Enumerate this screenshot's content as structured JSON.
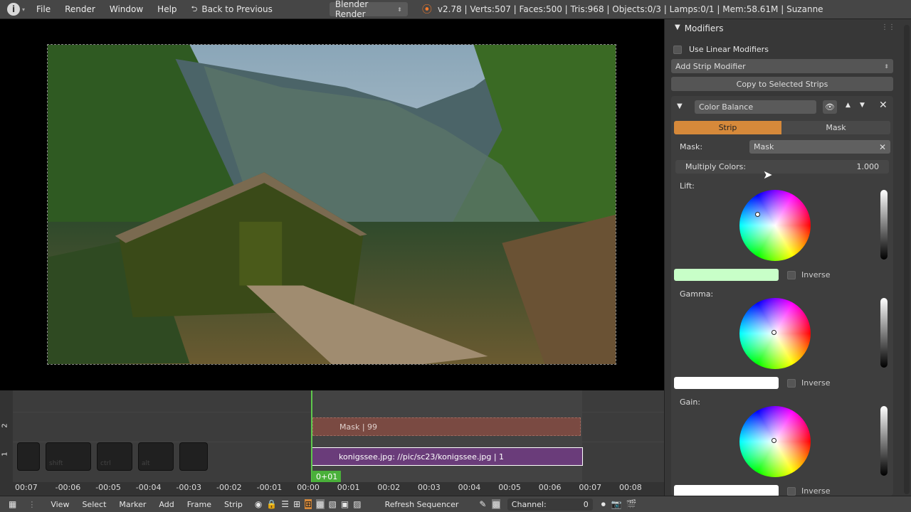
{
  "topbar": {
    "menus": [
      "File",
      "Render",
      "Window",
      "Help"
    ],
    "back": "Back to Previous",
    "engine": "Blender Render",
    "stats": "v2.78 | Verts:507 | Faces:500 | Tris:968 | Objects:0/3 | Lamps:0/1 | Mem:58.61M | Suzanne"
  },
  "panel": {
    "header": "Modifiers",
    "use_linear": "Use Linear Modifiers",
    "add_strip": "Add Strip Modifier",
    "copy": "Copy to Selected Strips",
    "modifier_name": "Color Balance",
    "tab_strip": "Strip",
    "tab_mask": "Mask",
    "mask_label": "Mask:",
    "mask_value": "Mask",
    "multiply_label": "Multiply Colors:",
    "multiply_value": "1.000",
    "lift_label": "Lift:",
    "gamma_label": "Gamma:",
    "gain_label": "Gain:",
    "inverse": "Inverse",
    "lift_color": "#c8ffc8",
    "gamma_color": "#ffffff",
    "gain_color": "#ffffff"
  },
  "sequencer": {
    "channel2": "2",
    "channel1": "1",
    "mask_strip": "Mask | 99",
    "image_strip": "konigssee.jpg: //pic/sc23/konigssee.jpg | 1",
    "frame_badge": "0+01",
    "keys": [
      "",
      "shift",
      "ctrl",
      "alt",
      ""
    ],
    "ticks": [
      "00:07",
      "-00:06",
      "-00:05",
      "-00:04",
      "-00:03",
      "-00:02",
      "-00:01",
      "00:00",
      "00:01",
      "00:02",
      "00:03",
      "00:04",
      "00:05",
      "00:06",
      "00:07",
      "00:08"
    ]
  },
  "bottombar": {
    "menus": [
      "View",
      "Select",
      "Marker",
      "Add",
      "Frame",
      "Strip"
    ],
    "refresh": "Refresh Sequencer",
    "channel_label": "Channel:",
    "channel_value": "0"
  }
}
